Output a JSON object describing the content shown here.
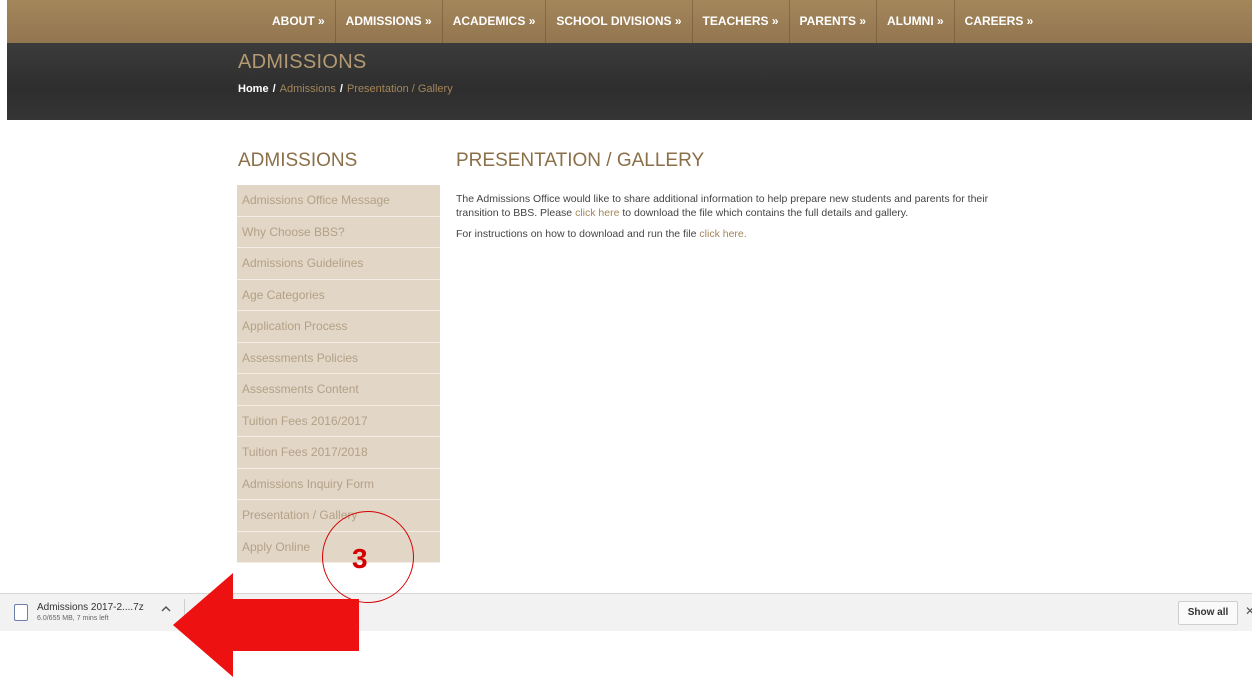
{
  "nav": {
    "items": [
      "ABOUT »",
      "ADMISSIONS »",
      "ACADEMICS »",
      "SCHOOL DIVISIONS »",
      "TEACHERS »",
      "PARENTS »",
      "ALUMNI »",
      "CAREERS »"
    ]
  },
  "hero": {
    "title": "ADMISSIONS",
    "breadcrumb": {
      "home": "Home",
      "sep": "/",
      "section": "Admissions",
      "current": "Presentation / Gallery"
    }
  },
  "sidebar": {
    "title": "ADMISSIONS",
    "items": [
      "Admissions Office Message",
      "Why Choose BBS?",
      "Admissions Guidelines",
      "Age Categories",
      "Application Process",
      "Assessments Policies",
      "Assessments Content",
      "Tuition Fees 2016/2017",
      "Tuition Fees 2017/2018",
      "Admissions Inquiry Form",
      "Presentation / Gallery",
      "Apply Online"
    ]
  },
  "main": {
    "title": "PRESENTATION / GALLERY",
    "para1_a": "The Admissions Office would like to share additional information to help prepare new students and parents for their transition to BBS. Please ",
    "para1_link": "click here",
    "para1_b": " to download the file which contains the full details and gallery.",
    "para2_a": "For instructions on how to download and run the file ",
    "para2_link": "click here."
  },
  "download": {
    "filename": "Admissions 2017-2....7z",
    "status": "6.0/655 MB, 7 mins left",
    "show_all": "Show all",
    "close": "✕"
  },
  "annotation": {
    "step_number": "3",
    "color": "#d40000"
  }
}
